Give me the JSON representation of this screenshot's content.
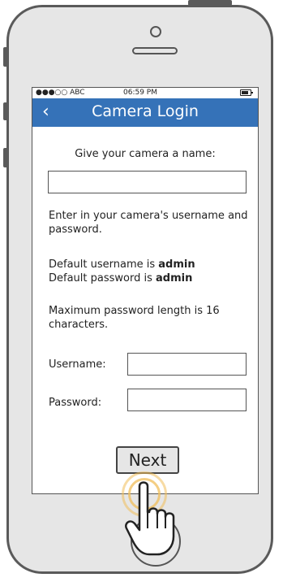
{
  "status_bar": {
    "carrier": "●●●○○ ABC",
    "time": "06:59 PM",
    "battery_icon": "battery-icon"
  },
  "nav": {
    "back_icon": "‹",
    "title": "Camera Login"
  },
  "form": {
    "name_prompt": "Give your camera a name:",
    "name_value": "",
    "instructions": "Enter in your camera's username and password.",
    "default_username_prefix": "Default username is ",
    "default_username_value": "admin",
    "default_password_prefix": "Default password is ",
    "default_password_value": "admin",
    "max_length_note": "Maximum password length is 16 characters.",
    "username_label": "Username:",
    "username_value": "",
    "password_label": "Password:",
    "password_value": "",
    "next_label": "Next"
  },
  "colors": {
    "navbar": "#3572b8",
    "tap_highlight": "#f0be5a"
  }
}
